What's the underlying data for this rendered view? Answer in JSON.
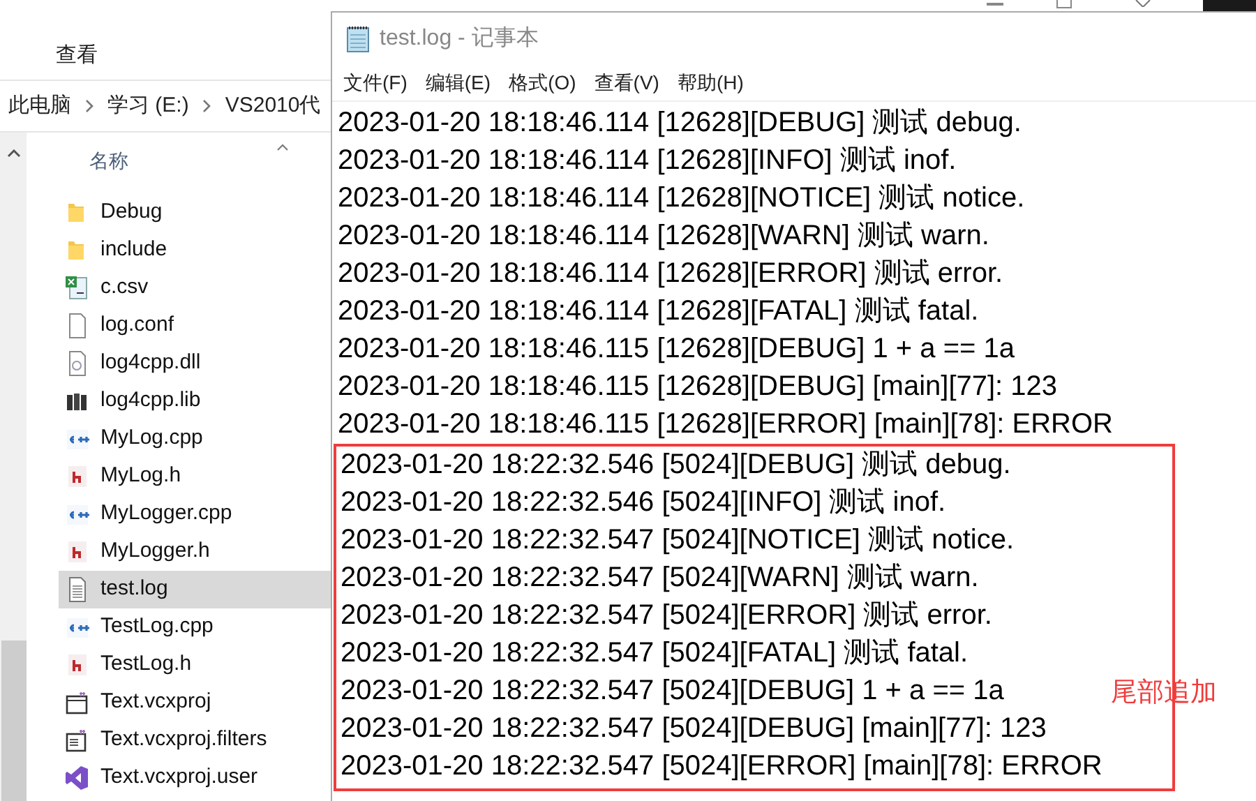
{
  "explorer": {
    "tab": "查看",
    "breadcrumb": [
      "此电脑",
      "学习 (E:)",
      "VS2010代"
    ],
    "column_header": "名称",
    "files": [
      {
        "name": "Debug",
        "kind": "folder",
        "selected": false
      },
      {
        "name": "include",
        "kind": "folder",
        "selected": false
      },
      {
        "name": "c.csv",
        "kind": "csv",
        "selected": false
      },
      {
        "name": "log.conf",
        "kind": "blank",
        "selected": false
      },
      {
        "name": "log4cpp.dll",
        "kind": "dll",
        "selected": false
      },
      {
        "name": "log4cpp.lib",
        "kind": "lib",
        "selected": false
      },
      {
        "name": "MyLog.cpp",
        "kind": "cpp",
        "selected": false
      },
      {
        "name": "MyLog.h",
        "kind": "h",
        "selected": false
      },
      {
        "name": "MyLogger.cpp",
        "kind": "cpp",
        "selected": false
      },
      {
        "name": "MyLogger.h",
        "kind": "h",
        "selected": false
      },
      {
        "name": "test.log",
        "kind": "text",
        "selected": true
      },
      {
        "name": "TestLog.cpp",
        "kind": "cpp",
        "selected": false
      },
      {
        "name": "TestLog.h",
        "kind": "h",
        "selected": false
      },
      {
        "name": "Text.vcxproj",
        "kind": "project",
        "selected": false
      },
      {
        "name": "Text.vcxproj.filters",
        "kind": "filters",
        "selected": false
      },
      {
        "name": "Text.vcxproj.user",
        "kind": "vs",
        "selected": false
      }
    ]
  },
  "notepad": {
    "title": "test.log - 记事本",
    "menu": [
      "文件(F)",
      "编辑(E)",
      "格式(O)",
      "查看(V)",
      "帮助(H)"
    ],
    "lines": [
      "2023-01-20 18:18:46.114 [12628][DEBUG] 测试 debug.",
      "2023-01-20 18:18:46.114 [12628][INFO] 测试 inof.",
      "2023-01-20 18:18:46.114 [12628][NOTICE] 测试 notice.",
      "2023-01-20 18:18:46.114 [12628][WARN] 测试 warn.",
      "2023-01-20 18:18:46.114 [12628][ERROR] 测试 error.",
      "2023-01-20 18:18:46.114 [12628][FATAL] 测试 fatal.",
      "2023-01-20 18:18:46.115 [12628][DEBUG] 1 + a == 1a",
      "2023-01-20 18:18:46.115 [12628][DEBUG] [main][77]: 123",
      "2023-01-20 18:18:46.115 [12628][ERROR] [main][78]: ERROR"
    ],
    "annotation": {
      "label": "尾部追加",
      "lines": [
        "2023-01-20 18:22:32.546 [5024][DEBUG] 测试 debug.",
        "2023-01-20 18:22:32.546 [5024][INFO] 测试 inof.",
        "2023-01-20 18:22:32.547 [5024][NOTICE] 测试 notice.",
        "2023-01-20 18:22:32.547 [5024][WARN] 测试 warn.",
        "2023-01-20 18:22:32.547 [5024][ERROR] 测试 error.",
        "2023-01-20 18:22:32.547 [5024][FATAL] 测试 fatal.",
        "2023-01-20 18:22:32.547 [5024][DEBUG] 1 + a == 1a",
        "2023-01-20 18:22:32.547 [5024][DEBUG] [main][77]: 123",
        "2023-01-20 18:22:32.547 [5024][ERROR] [main][78]: ERROR"
      ]
    }
  }
}
